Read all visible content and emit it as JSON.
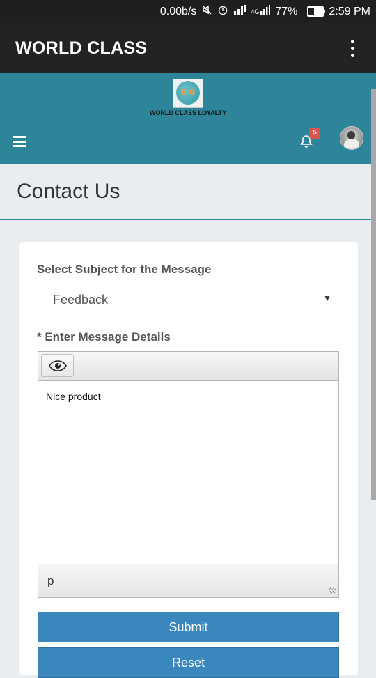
{
  "status_bar": {
    "net_speed": "0.00b/s",
    "signal_label": "4G",
    "battery": "77%",
    "time": "2:59 PM"
  },
  "app_bar": {
    "title": "WORLD CLASS"
  },
  "header": {
    "logo_text": "WORLD CLASS LOYALTY",
    "logo_mark": "S G",
    "notification_count": "5"
  },
  "page": {
    "title": "Contact Us"
  },
  "form": {
    "subject_label": "Select Subject for the Message",
    "subject_value": "Feedback",
    "message_label": "* Enter Message Details",
    "message_value": "Nice product",
    "editor_path": "p",
    "submit_label": "Submit",
    "reset_label": "Reset"
  },
  "colors": {
    "header_teal": "#2e8599",
    "button_blue": "#3a87bd",
    "badge_red": "#d9534f"
  }
}
